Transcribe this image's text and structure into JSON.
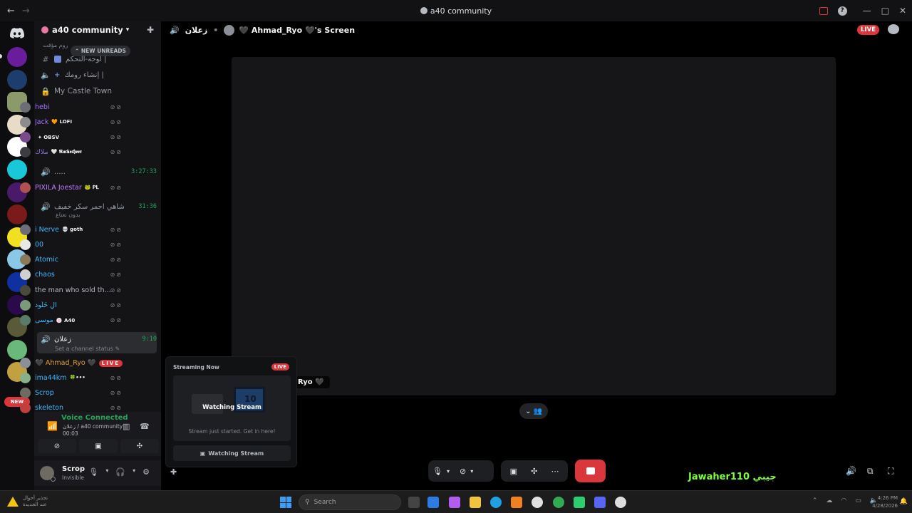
{
  "window": {
    "title": "a40 community",
    "back": "←",
    "forward": "→",
    "minimize": "—",
    "maximize": "□",
    "close": "✕",
    "help": "?"
  },
  "guild": {
    "name": "a40 community",
    "new_unreads": "NEW UNREADS"
  },
  "channels": {
    "top_partial": "روم مؤقت",
    "control_panel": "لوحة-التحكم |",
    "create_room": "إنشاء رومك |",
    "castle_town": "My Castle Town",
    "voice1": {
      "name": ".....",
      "timer": "3:27:33"
    },
    "voice2": {
      "name": "شاهي احمر سكر خفيف",
      "sub": "بدون نعناع",
      "timer": "31:36"
    },
    "active": {
      "name": "زعلان",
      "timer": "9:10",
      "status": "Set a channel status"
    }
  },
  "castle_members": [
    {
      "name": "hebi",
      "tag": "",
      "color": "#a970ff",
      "avatar": "#6d6d77"
    },
    {
      "name": "Jack",
      "tag": "🧡 LOFI",
      "color": "#a970ff",
      "avatar": "#8c8c8c"
    },
    {
      "name": "",
      "tag": "✦ OBSV",
      "color": "#3b3bb0",
      "avatar": "#7a4b8a"
    },
    {
      "name": "ملاك",
      "tag": "🤍 𝕽𝖆𝖈𝖐𝖊𝖈𝖍𝖊𝖊𝖗",
      "color": "#8a6cd8",
      "avatar": "#3c3c42"
    }
  ],
  "voice1_members": [
    {
      "name": "PIXILA Joestar",
      "tag": "🐸 𝐏𝐋",
      "color": "#c27cff",
      "avatar": "#b05050"
    }
  ],
  "voice2_members": [
    {
      "name": "i Nerve",
      "tag": "💀 goth",
      "color": "#3fb8ff",
      "avatar": "#6d6d77"
    },
    {
      "name": "00",
      "tag": "",
      "color": "#3fb8ff",
      "avatar": "#e8e8e8"
    },
    {
      "name": "Atomic",
      "tag": "",
      "color": "#3fb8ff",
      "avatar": "#8a7a5a"
    },
    {
      "name": "chaos",
      "tag": "",
      "color": "#3fb8ff",
      "avatar": "#d0d0d0"
    },
    {
      "name": "the man who sold th...",
      "tag": "",
      "color": "#b5bac1",
      "avatar": "#4a4a3a"
    },
    {
      "name": "آلِ خَلّود",
      "tag": "",
      "color": "#3fb8ff",
      "avatar": "#7a9a7a"
    },
    {
      "name": "موسى",
      "tag": "🍥 A40",
      "color": "#3fb8ff",
      "avatar": "#5a7a6a"
    }
  ],
  "active_members": [
    {
      "name": "🖤 Ahmad_Ryo 🖤",
      "tag": "",
      "color": "#e0a030",
      "avatar": "#8a8f98",
      "live": "LIVE"
    },
    {
      "name": "ima44km",
      "tag": "🍀•••",
      "color": "#3fb8ff",
      "avatar": "#8ab08a"
    },
    {
      "name": "Scrop",
      "tag": "",
      "color": "#3fb8ff",
      "avatar": "#6f6b63"
    },
    {
      "name": "skeleton",
      "tag": "",
      "color": "#3fb8ff",
      "avatar": "#c04040"
    }
  ],
  "voice_panel": {
    "status": "Voice Connected",
    "sub": "زعلان / a40 community",
    "time": "00:03"
  },
  "user": {
    "name": "Scrop",
    "status": "Invisible"
  },
  "stage": {
    "channel": "زعلان",
    "streamer": "🖤 Ahmad_Ryo 🖤's Screen",
    "live": "LIVE",
    "name_tag": "Ryo 🖤"
  },
  "popup": {
    "header": "Streaming Now",
    "live": "LIVE",
    "watching": "Watching Stream",
    "sub": "Stream just started. Get in here!",
    "button": "Watching Stream"
  },
  "overlay": {
    "text": "Jawaher110  جيبي"
  },
  "rail": {
    "new": "NEW"
  },
  "taskbar": {
    "weather_line1": "تحذير أحوال",
    "weather_line2": "عند الجديدة",
    "search": "Search",
    "time": "4:26 PM",
    "date": "4/28/2026"
  },
  "colors": {
    "accent": "#da373c",
    "online": "#23a559",
    "bg": "#141417"
  }
}
